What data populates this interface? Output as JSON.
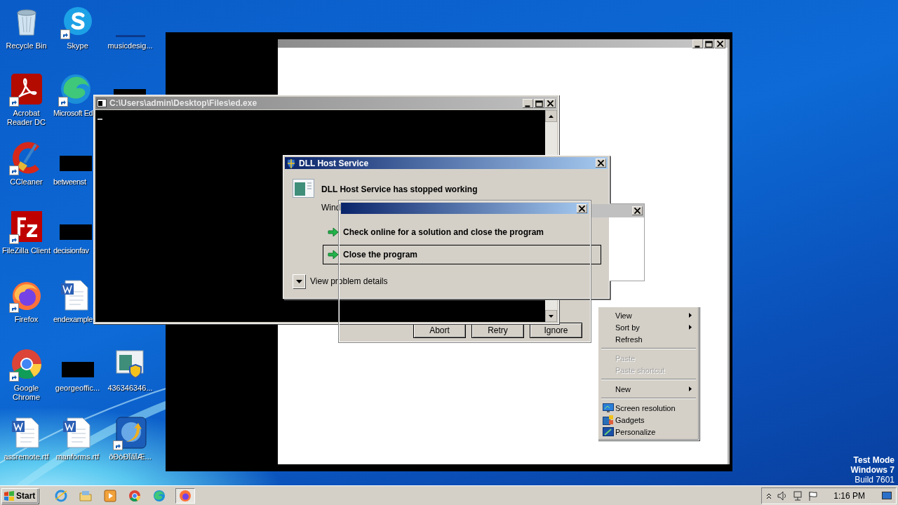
{
  "desktop_icons": [
    {
      "label": "Recycle Bin",
      "kind": "recycle",
      "shortcut": false
    },
    {
      "label": "Skype",
      "kind": "skype",
      "shortcut": true
    },
    {
      "label": "musicdesig...",
      "kind": "dim",
      "shortcut": false
    },
    {
      "label": "Acrobat Reader DC",
      "kind": "acrobat",
      "shortcut": true
    },
    {
      "label": "Microsoft Ed",
      "kind": "edge",
      "shortcut": true
    },
    {
      "kind": "blank",
      "shortcut": false
    },
    {
      "label": "CCleaner",
      "kind": "ccleaner",
      "shortcut": true
    },
    {
      "label": "betweenst",
      "kind": "blank",
      "shortcut": false
    },
    {
      "label": "FileZilla Client",
      "kind": "filezilla",
      "shortcut": true
    },
    {
      "label": "decisionfav",
      "kind": "blank",
      "shortcut": false
    },
    {
      "label": "Firefox",
      "kind": "firefox",
      "shortcut": true
    },
    {
      "label": "endexample",
      "kind": "word",
      "shortcut": false
    },
    {
      "label": "Google Chrome",
      "kind": "chrome",
      "shortcut": true
    },
    {
      "label": "georgeoffic...",
      "kind": "blank",
      "shortcut": false
    },
    {
      "label": "436346346...",
      "kind": "setup",
      "shortcut": false
    },
    {
      "label": "assremote.rtf",
      "kind": "word",
      "shortcut": false
    },
    {
      "label": "manforms.rtf",
      "kind": "word",
      "shortcut": false
    },
    {
      "label": "ðÐòÐÏãÏÆ...",
      "kind": "installer",
      "shortcut": true
    }
  ],
  "console_window": {
    "title": "C:\\Users\\admin\\Desktop\\Files\\ed.exe"
  },
  "error_dialog": {
    "title": "DLL Host Service",
    "heading": "DLL Host Service has stopped working",
    "message": "Wind",
    "options": [
      {
        "label": "Check online for a solution and close the program",
        "selected": false
      },
      {
        "label": "Close the program",
        "selected": true
      }
    ],
    "details_toggle": "View problem details"
  },
  "message_box": {
    "buttons": [
      "Abort",
      "Retry",
      "Ignore"
    ]
  },
  "context_menu": {
    "items": [
      {
        "kind": "submenu",
        "label": "View",
        "disabled": false
      },
      {
        "kind": "submenu",
        "label": "Sort by",
        "disabled": false
      },
      {
        "kind": "plain",
        "label": "Refresh",
        "disabled": false
      },
      {
        "kind": "separator"
      },
      {
        "kind": "plain",
        "label": "Paste",
        "disabled": true
      },
      {
        "kind": "plain",
        "label": "Paste shortcut",
        "disabled": true
      },
      {
        "kind": "separator"
      },
      {
        "kind": "submenu",
        "label": "New",
        "disabled": false
      },
      {
        "kind": "separator"
      },
      {
        "kind": "icon",
        "label": "Screen resolution",
        "disabled": false
      },
      {
        "kind": "icon",
        "label": "Gadgets",
        "disabled": false
      },
      {
        "kind": "icon",
        "label": "Personalize",
        "disabled": false
      }
    ]
  },
  "os_notice": [
    "Test Mode",
    "Windows 7",
    "Build 7601"
  ],
  "taskbar": {
    "start": "Start",
    "apps": [
      {
        "selected": false
      },
      {
        "selected": false
      },
      {
        "selected": false
      },
      {
        "selected": false
      },
      {
        "selected": false
      },
      {
        "selected": true
      }
    ],
    "clock": "1:16 PM"
  }
}
